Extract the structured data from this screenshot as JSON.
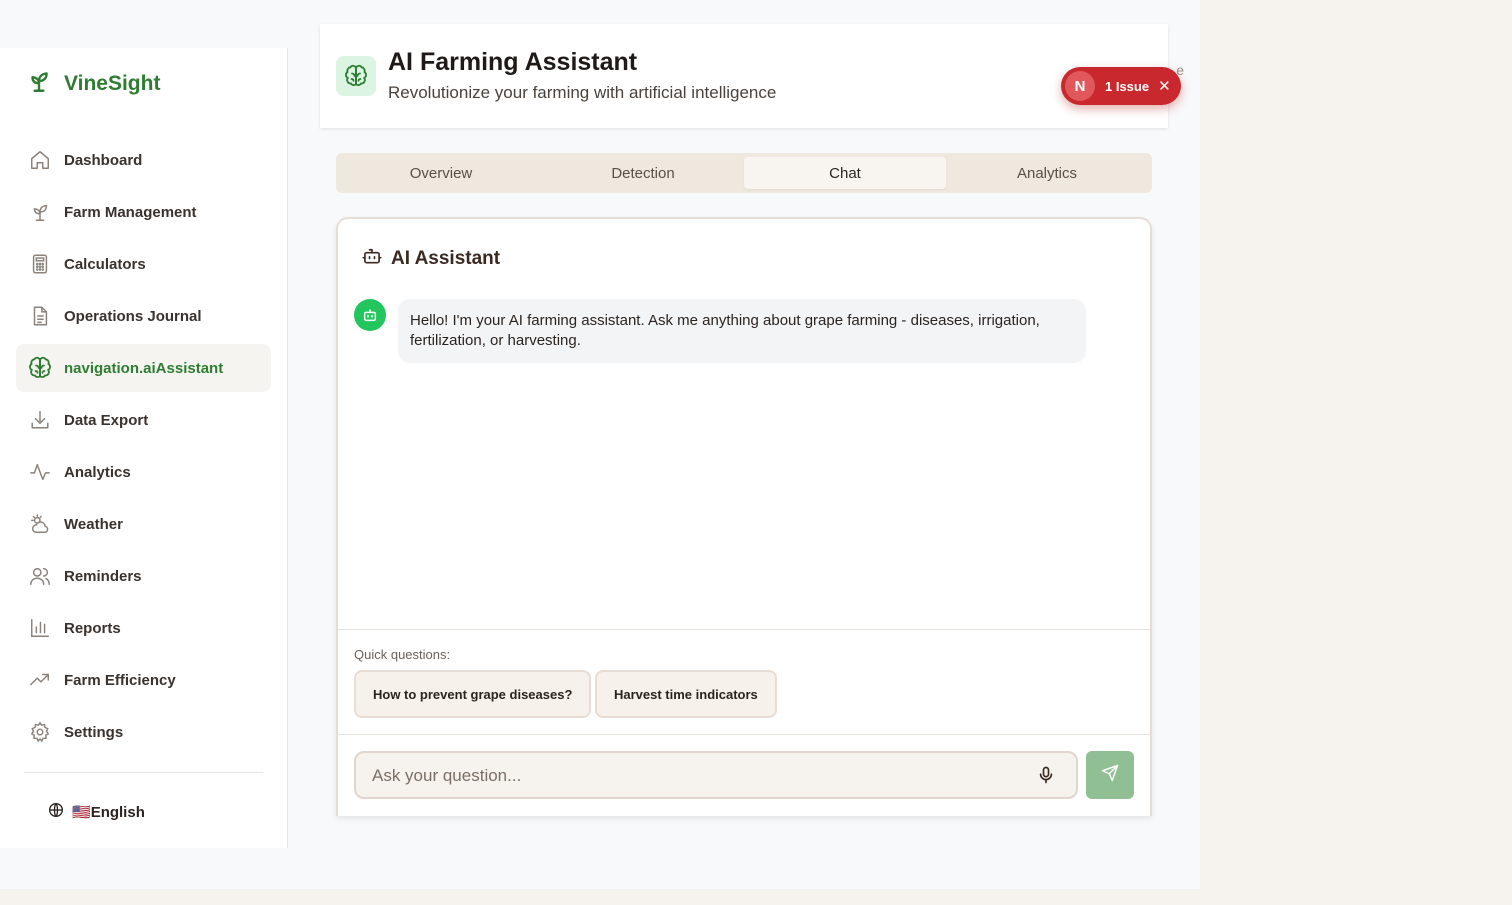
{
  "brand": {
    "name": "VineSight"
  },
  "sidebar": {
    "items": [
      {
        "label": "Dashboard",
        "icon": "home-icon"
      },
      {
        "label": "Farm Management",
        "icon": "sprout-icon"
      },
      {
        "label": "Calculators",
        "icon": "calculator-icon"
      },
      {
        "label": "Operations Journal",
        "icon": "document-icon"
      },
      {
        "label": "navigation.aiAssistant",
        "icon": "brain-icon",
        "active": true
      },
      {
        "label": "Data Export",
        "icon": "download-icon"
      },
      {
        "label": "Analytics",
        "icon": "activity-icon"
      },
      {
        "label": "Weather",
        "icon": "cloud-sun-icon"
      },
      {
        "label": "Reminders",
        "icon": "users-icon"
      },
      {
        "label": "Reports",
        "icon": "bar-chart-icon"
      },
      {
        "label": "Farm Efficiency",
        "icon": "trending-up-icon"
      },
      {
        "label": "Settings",
        "icon": "gear-icon"
      }
    ],
    "language": {
      "flag": "🇺🇸",
      "label": "English"
    }
  },
  "header": {
    "title": "AI Farming Assistant",
    "subtitle": "Revolutionize your farming with artificial intelligence",
    "peek_text": "e"
  },
  "issue_badge": {
    "letter": "N",
    "label": "1 Issue",
    "close": "✕"
  },
  "tabs": [
    {
      "label": "Overview"
    },
    {
      "label": "Detection"
    },
    {
      "label": "Chat",
      "active": true
    },
    {
      "label": "Analytics"
    }
  ],
  "chat": {
    "title": "AI Assistant",
    "messages": [
      {
        "role": "assistant",
        "text": "Hello! I'm your AI farming assistant. Ask me anything about grape farming - diseases, irrigation, fertilization, or harvesting."
      }
    ],
    "quick_label": "Quick questions:",
    "quick_questions": [
      "How to prevent grape diseases?",
      "Harvest time indicators"
    ],
    "input": {
      "value": "",
      "placeholder": "Ask your question..."
    }
  },
  "colors": {
    "brand_green": "#2e7d32",
    "bot_green": "#22c55e",
    "issue_red": "#c8282e",
    "send_green": "#8fbf92"
  }
}
